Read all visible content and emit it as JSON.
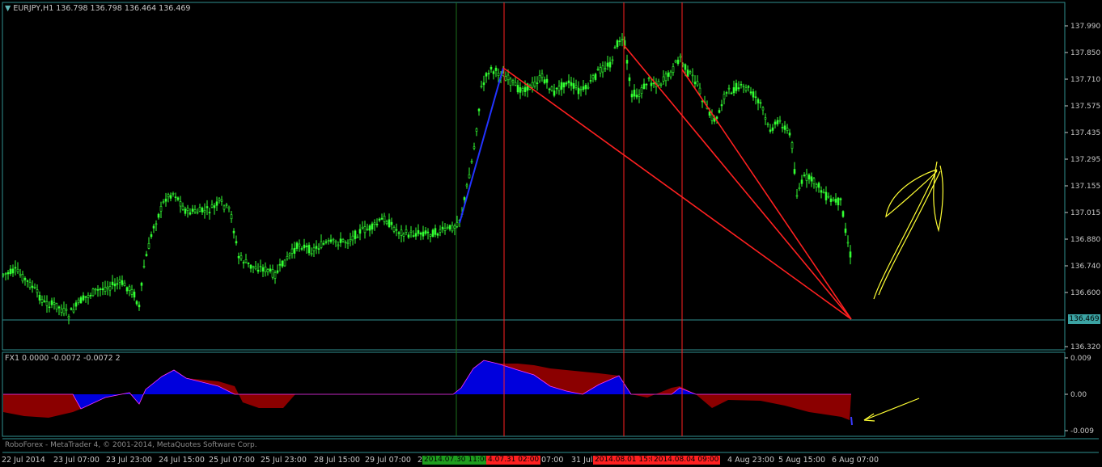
{
  "window": {
    "symbol_header": "EURJPY,H1  136.798 136.798 136.464 136.469",
    "indicator_header": "FX1 0.0000 -0.0072 -0.0072  2",
    "broker_line": "RoboForex - MetaTrader 4, © 2001-2014, MetaQuotes Software Corp.",
    "current_price": "136.469"
  },
  "colors": {
    "background": "#000000",
    "grid": "#2f8f8f",
    "candle": "#33ff33",
    "vline": "#ff2020",
    "fan": "#ff2020",
    "blue_leg": "#2233ff",
    "hist_pos": "#0000dd",
    "hist_neg": "#8b0000",
    "annotation": "#ffff33",
    "tag_green": "#1e9e1e",
    "tag_red": "#ff2020",
    "price_tag": "#3ba3a3"
  },
  "price_axis": [
    "137.990",
    "137.850",
    "137.710",
    "137.575",
    "137.435",
    "137.295",
    "137.155",
    "137.015",
    "136.880",
    "136.740",
    "136.600",
    "136.469",
    "136.320"
  ],
  "indicator_axis": [
    "0.009",
    "0.00",
    "-0.009"
  ],
  "time_axis": [
    {
      "label": "22 Jul 2014"
    },
    {
      "label": "23 Jul 07:00"
    },
    {
      "label": "23 Jul 23:00"
    },
    {
      "label": "24 Jul 15:00"
    },
    {
      "label": "25 Jul 07:00"
    },
    {
      "label": "25 Jul 23:00"
    },
    {
      "label": "28 Jul 15:00"
    },
    {
      "label": "29 Jul 07:00"
    },
    {
      "label": "29"
    },
    {
      "label": "07:00"
    },
    {
      "label": "31 Jul"
    },
    {
      "label": "4 Aug 23:00"
    },
    {
      "label": "5 Aug 15:00"
    },
    {
      "label": "6 Aug 07:00"
    }
  ],
  "time_tags": [
    {
      "label": "2014.07.30 11:00",
      "color": "green"
    },
    {
      "label": "4.07.31 02:00",
      "color": "red"
    },
    {
      "label": "2014.08.01 15:0",
      "color": "red"
    },
    {
      "label": "2014.08.04 09:00",
      "color": "red"
    }
  ],
  "icons": {
    "menu": "triangle-down-icon"
  }
}
